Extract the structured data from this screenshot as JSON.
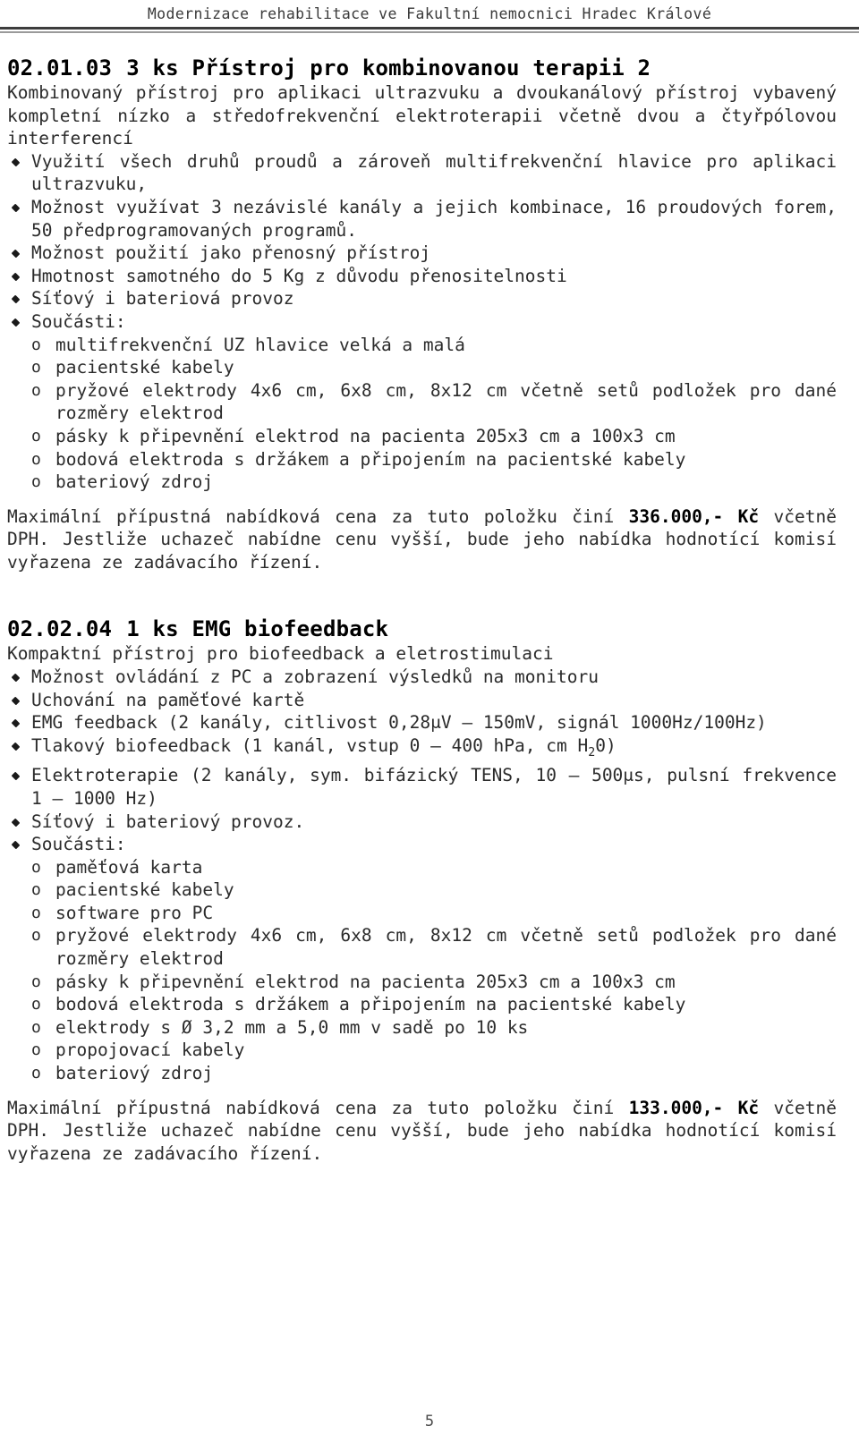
{
  "header": {
    "title": "Modernizace rehabilitace ve Fakultní nemocnici Hradec Králové"
  },
  "footer": {
    "page_number": "5"
  },
  "sections": [
    {
      "number": "02.01.03",
      "title": "3 ks Přístroj pro kombinovanou terapii 2",
      "intro": "Kombinovaný přístroj pro aplikaci ultrazvuku a dvoukanálový přístroj vybavený kompletní nízko a středofrekvenční elektroterapii včetně dvou a čtyřpólovou interferencí",
      "bullets": [
        "Využití všech druhů proudů a zároveň multifrekvenční hlavice pro aplikaci ultrazvuku,",
        "Možnost využívat 3 nezávislé kanály a jejich kombinace, 16 proudových forem, 50 předprogramovaných programů.",
        "Možnost použití jako přenosný přístroj",
        "Hmotnost samotného do 5 Kg z důvodu přenositelnosti",
        "Síťový i bateriová provoz",
        "Součásti:"
      ],
      "subitems": [
        "multifrekvenční UZ hlavice velká a malá",
        "pacientské kabely",
        "pryžové elektrody 4x6 cm, 6x8 cm, 8x12 cm včetně setů podložek pro dané rozměry elektrod",
        "pásky k připevnění elektrod na pacienta 205x3 cm a 100x3 cm",
        "bodová elektroda s držákem a připojením na pacientské kabely",
        "bateriový zdroj"
      ],
      "price": {
        "prefix": "Maximální přípustná nabídková cena za tuto položku činí ",
        "amount": "336.000,- Kč",
        "suffix": " včetně DPH. Jestliže uchazeč nabídne cenu vyšší, bude jeho nabídka hodnotící komisí vyřazena ze zadávacího řízení."
      }
    },
    {
      "number": "02.02.04",
      "title": "1 ks EMG biofeedback",
      "intro": "Kompaktní přístroj pro biofeedback a eletrostimulaci",
      "bullets": [
        "Možnost ovládání z PC a zobrazení výsledků na monitoru",
        "Uchování na paměťové kartě",
        "EMG feedback (2 kanály, citlivost 0,28μV – 150mV, signál 1000Hz/100Hz)",
        "Tlakový biofeedback (1 kanál, vstup 0 – 400 hPa, cm H₂0)",
        "Elektroterapie (2 kanály, sym. bifázický TENS, 10 – 500μs, pulsní frekvence 1 – 1000 Hz)",
        "Síťový i bateriový provoz.",
        "Součásti:"
      ],
      "subitems": [
        "paměťová karta",
        "pacientské kabely",
        "software pro PC",
        "pryžové elektrody 4x6 cm, 6x8 cm, 8x12 cm včetně setů podložek pro dané rozměry elektrod",
        "pásky k připevnění elektrod na pacienta 205x3 cm a 100x3 cm",
        "bodová elektroda s držákem a připojením na pacientské kabely",
        "elektrody s Ø 3,2 mm a 5,0 mm v sadě po 10 ks",
        "propojovací kabely",
        "bateriový zdroj"
      ],
      "price": {
        "prefix": "Maximální přípustná nabídková cena za tuto položku činí ",
        "amount": "133.000,- Kč",
        "suffix": " včetně DPH. Jestliže uchazeč nabídne cenu vyšší, bude jeho nabídka hodnotící komisí vyřazena ze zadávacího řízení."
      }
    }
  ]
}
